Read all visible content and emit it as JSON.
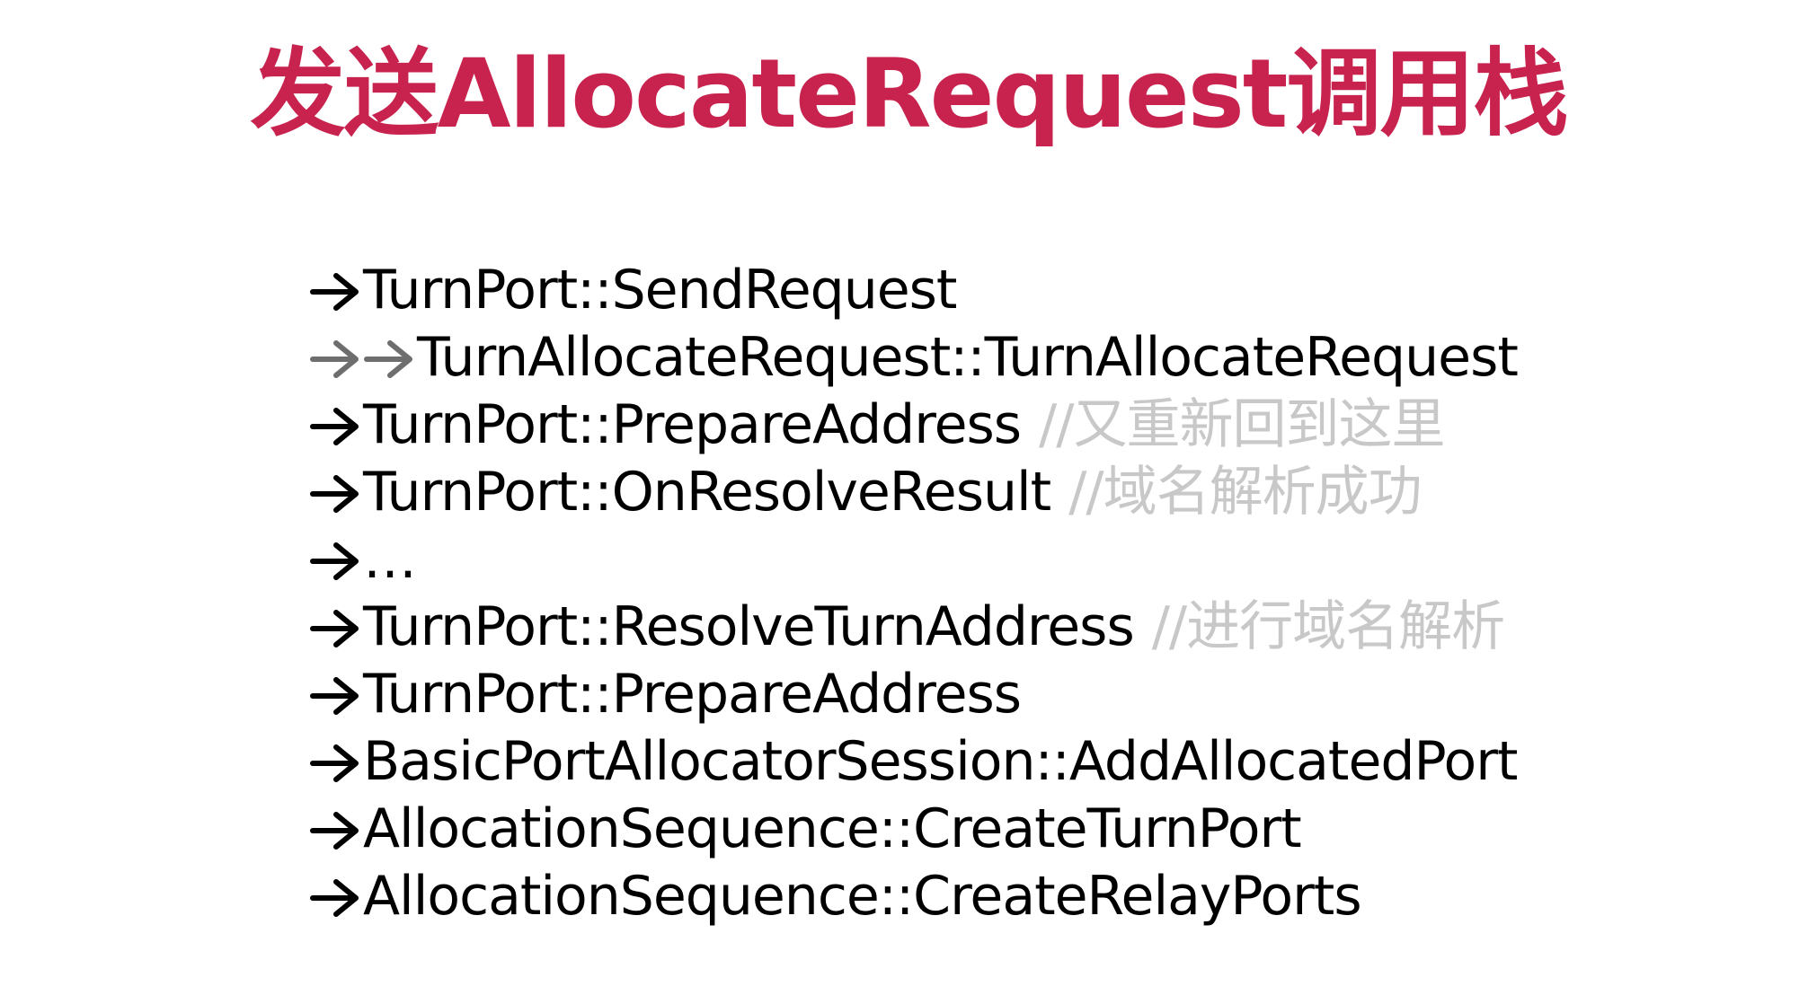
{
  "title": "发送AllocateRequest调用栈",
  "call_stack": [
    {
      "arrows": [
        "arrow-right"
      ],
      "func": "TurnPort::SendRequest",
      "comment": ""
    },
    {
      "arrows": [
        "arrow-right-gray",
        "arrow-right-gray"
      ],
      "func": "TurnAllocateRequest::TurnAllocateRequest",
      "comment": ""
    },
    {
      "arrows": [
        "arrow-right"
      ],
      "func": "TurnPort::PrepareAddress",
      "comment": "//又重新回到这里"
    },
    {
      "arrows": [
        "arrow-right"
      ],
      "func": "TurnPort::OnResolveResult",
      "comment": "//域名解析成功"
    },
    {
      "arrows": [
        "arrow-right"
      ],
      "func": "…",
      "comment": ""
    },
    {
      "arrows": [
        "arrow-right"
      ],
      "func": "TurnPort::ResolveTurnAddress",
      "comment": "//进行域名解析"
    },
    {
      "arrows": [
        "arrow-right"
      ],
      "func": "TurnPort::PrepareAddress",
      "comment": ""
    },
    {
      "arrows": [
        "arrow-right"
      ],
      "func": "BasicPortAllocatorSession::AddAllocatedPort",
      "comment": ""
    },
    {
      "arrows": [
        "arrow-right"
      ],
      "func": "AllocationSequence::CreateTurnPort",
      "comment": ""
    },
    {
      "arrows": [
        "arrow-right"
      ],
      "func": "AllocationSequence::CreateRelayPorts",
      "comment": ""
    }
  ],
  "colors": {
    "title": "#c8234e",
    "text": "#000000",
    "comment": "#c8c8c8",
    "secondary_arrow": "#6e6e6e"
  }
}
